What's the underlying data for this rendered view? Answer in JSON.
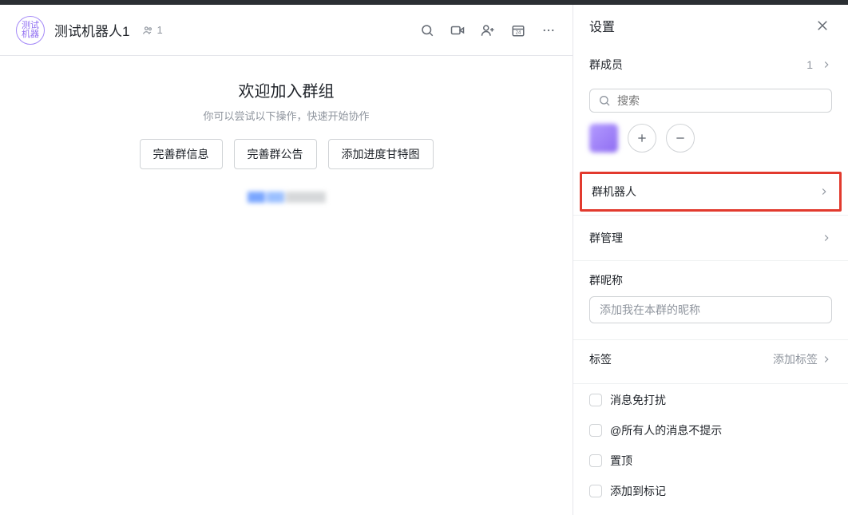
{
  "header": {
    "avatar_text": "测试\n机器",
    "title": "测试机器人1",
    "member_count": "1"
  },
  "content": {
    "welcome_title": "欢迎加入群组",
    "welcome_sub": "你可以尝试以下操作，快速开始协作",
    "actions": [
      "完善群信息",
      "完善群公告",
      "添加进度甘特图"
    ]
  },
  "panel": {
    "title": "设置",
    "members": {
      "label": "群成员",
      "count": "1",
      "search_placeholder": "搜索"
    },
    "bots": {
      "label": "群机器人"
    },
    "admin": {
      "label": "群管理"
    },
    "nickname": {
      "label": "群昵称",
      "placeholder": "添加我在本群的昵称"
    },
    "tags": {
      "label": "标签",
      "add_label": "添加标签"
    },
    "options": {
      "mute": "消息免打扰",
      "no_at_all": "@所有人的消息不提示",
      "pin": "置顶",
      "add_mark": "添加到标记"
    }
  }
}
